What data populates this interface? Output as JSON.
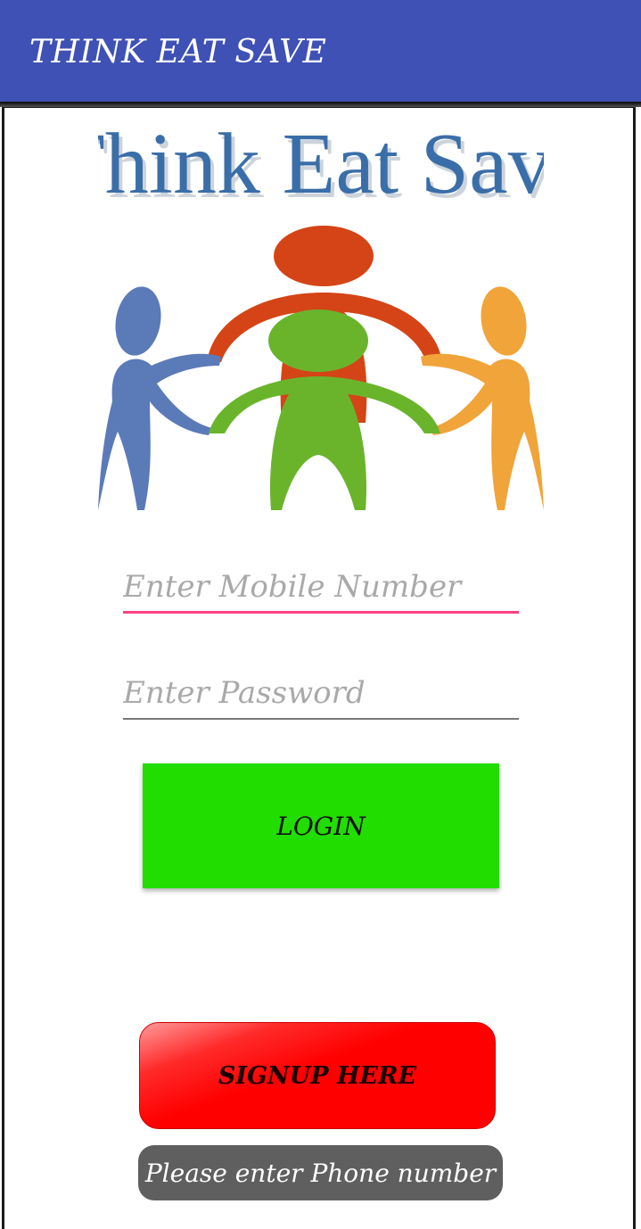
{
  "app_bar": {
    "title": "THINK EAT SAVE"
  },
  "logo": {
    "text": "Think Eat Save",
    "figure_colors": {
      "blue": "#5b7ab8",
      "red": "#d44416",
      "green": "#6ab42c",
      "orange": "#f0a43a",
      "text": "#3a6ea8"
    }
  },
  "form": {
    "mobile_placeholder": "Enter Mobile Number",
    "password_placeholder": "Enter Password",
    "login_label": "LOGIN",
    "signup_label": "SIGNUP HERE"
  },
  "toast": {
    "message": "Please enter Phone number"
  },
  "colors": {
    "app_bar": "#3f51b5",
    "focused_underline": "#ff4081",
    "login_button": "#22dd00",
    "signup_button": "#ff0000",
    "toast": "#5f5f5f"
  }
}
